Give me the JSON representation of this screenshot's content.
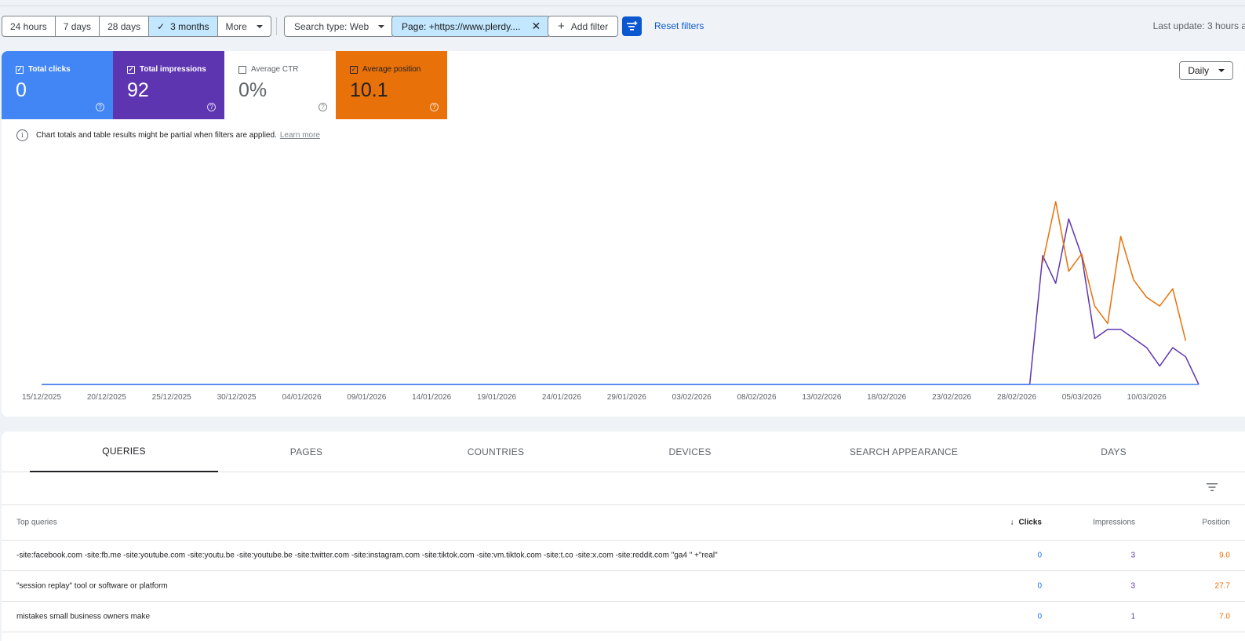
{
  "filters": {
    "ranges": [
      "24 hours",
      "7 days",
      "28 days",
      "3 months",
      "More"
    ],
    "active_range": "3 months",
    "search_type": "Search type: Web",
    "page_filter": "Page: +https://www.plerdy....",
    "add_filter": "Add filter",
    "reset": "Reset filters",
    "last_update": "Last update: 3 hours a"
  },
  "metrics": [
    {
      "label": "Total clicks",
      "value": "0",
      "checked": true,
      "color": "#4285f4"
    },
    {
      "label": "Total impressions",
      "value": "92",
      "checked": true,
      "color": "#5e35b1"
    },
    {
      "label": "Average CTR",
      "value": "0%",
      "checked": false,
      "color": "#ffffff"
    },
    {
      "label": "Average position",
      "value": "10.1",
      "checked": true,
      "color": "#e8710a"
    }
  ],
  "granularity": "Daily",
  "notice": {
    "text": "Chart totals and table results might be partial when filters are applied.",
    "link": "Learn more"
  },
  "chart_data": {
    "type": "line",
    "x": [
      "15/12/2025",
      "16/12/2025",
      "17/12/2025",
      "18/12/2025",
      "19/12/2025",
      "20/12/2025",
      "21/12/2025",
      "22/12/2025",
      "23/12/2025",
      "24/12/2025",
      "25/12/2025",
      "26/12/2025",
      "27/12/2025",
      "28/12/2025",
      "29/12/2025",
      "30/12/2025",
      "31/12/2025",
      "01/01/2026",
      "02/01/2026",
      "03/01/2026",
      "04/01/2026",
      "05/01/2026",
      "06/01/2026",
      "07/01/2026",
      "08/01/2026",
      "09/01/2026",
      "10/01/2026",
      "11/01/2026",
      "12/01/2026",
      "13/01/2026",
      "14/01/2026",
      "15/01/2026",
      "16/01/2026",
      "17/01/2026",
      "18/01/2026",
      "19/01/2026",
      "20/01/2026",
      "21/01/2026",
      "22/01/2026",
      "23/01/2026",
      "24/01/2026",
      "25/01/2026",
      "26/01/2026",
      "27/01/2026",
      "28/01/2026",
      "29/01/2026",
      "30/01/2026",
      "31/01/2026",
      "01/02/2026",
      "02/02/2026",
      "03/02/2026",
      "04/02/2026",
      "05/02/2026",
      "06/02/2026",
      "07/02/2026",
      "08/02/2026",
      "09/02/2026",
      "10/02/2026",
      "11/02/2026",
      "12/02/2026",
      "13/02/2026",
      "14/02/2026",
      "15/02/2026",
      "16/02/2026",
      "17/02/2026",
      "18/02/2026",
      "19/02/2026",
      "20/02/2026",
      "21/02/2026",
      "22/02/2026",
      "23/02/2026",
      "24/02/2026",
      "25/02/2026",
      "26/02/2026",
      "27/02/2026",
      "28/02/2026",
      "01/03/2026",
      "02/03/2026",
      "03/03/2026",
      "04/03/2026",
      "05/03/2026",
      "06/03/2026",
      "07/03/2026",
      "08/03/2026",
      "09/03/2026",
      "10/03/2026",
      "11/03/2026",
      "12/03/2026",
      "13/03/2026",
      "14/03/2026"
    ],
    "tick_labels": [
      "15/12/2025",
      "20/12/2025",
      "25/12/2025",
      "30/12/2025",
      "04/01/2026",
      "09/01/2026",
      "14/01/2026",
      "19/01/2026",
      "24/01/2026",
      "29/01/2026",
      "03/02/2026",
      "08/02/2026",
      "13/02/2026",
      "18/02/2026",
      "23/02/2026",
      "28/02/2026",
      "05/03/2026",
      "10/03/2026"
    ],
    "series": [
      {
        "name": "Total clicks",
        "color": "#4285f4",
        "values": [
          0,
          0,
          0,
          0,
          0,
          0,
          0,
          0,
          0,
          0,
          0,
          0,
          0,
          0,
          0,
          0,
          0,
          0,
          0,
          0,
          0,
          0,
          0,
          0,
          0,
          0,
          0,
          0,
          0,
          0,
          0,
          0,
          0,
          0,
          0,
          0,
          0,
          0,
          0,
          0,
          0,
          0,
          0,
          0,
          0,
          0,
          0,
          0,
          0,
          0,
          0,
          0,
          0,
          0,
          0,
          0,
          0,
          0,
          0,
          0,
          0,
          0,
          0,
          0,
          0,
          0,
          0,
          0,
          0,
          0,
          0,
          0,
          0,
          0,
          0,
          0,
          0,
          0,
          0,
          0,
          0,
          0,
          0,
          0,
          0,
          0,
          0,
          0,
          0,
          0
        ]
      },
      {
        "name": "Total impressions",
        "color": "#5e35b1",
        "values": [
          0,
          0,
          0,
          0,
          0,
          0,
          0,
          0,
          0,
          0,
          0,
          0,
          0,
          0,
          0,
          0,
          0,
          0,
          0,
          0,
          0,
          0,
          0,
          0,
          0,
          0,
          0,
          0,
          0,
          0,
          0,
          0,
          0,
          0,
          0,
          0,
          0,
          0,
          0,
          0,
          0,
          0,
          0,
          0,
          0,
          0,
          0,
          0,
          0,
          0,
          0,
          0,
          0,
          0,
          0,
          0,
          0,
          0,
          0,
          0,
          0,
          0,
          0,
          0,
          0,
          0,
          0,
          0,
          0,
          0,
          0,
          0,
          0,
          0,
          0,
          0,
          0,
          14,
          11,
          18,
          14,
          5,
          6,
          6,
          5,
          4,
          2,
          4,
          3,
          0
        ]
      },
      {
        "name": "Average position",
        "color": "#e8710a",
        "values": [
          null,
          null,
          null,
          null,
          null,
          null,
          null,
          null,
          null,
          null,
          null,
          null,
          null,
          null,
          null,
          null,
          null,
          null,
          null,
          null,
          null,
          null,
          null,
          null,
          null,
          null,
          null,
          null,
          null,
          null,
          null,
          null,
          null,
          null,
          null,
          null,
          null,
          null,
          null,
          null,
          null,
          null,
          null,
          null,
          null,
          null,
          null,
          null,
          null,
          null,
          null,
          null,
          null,
          null,
          null,
          null,
          null,
          null,
          null,
          null,
          null,
          null,
          null,
          null,
          null,
          null,
          null,
          null,
          null,
          null,
          null,
          null,
          null,
          null,
          null,
          null,
          null,
          14,
          21,
          13,
          15,
          9,
          7,
          17,
          12,
          10,
          9,
          11,
          5
        ]
      }
    ]
  },
  "tabs": [
    "QUERIES",
    "PAGES",
    "COUNTRIES",
    "DEVICES",
    "SEARCH APPEARANCE",
    "DAYS"
  ],
  "active_tab": "QUERIES",
  "table": {
    "headers": {
      "query": "Top queries",
      "clicks": "Clicks",
      "impressions": "Impressions",
      "position": "Position"
    },
    "rows": [
      {
        "query": "-site:facebook.com -site:fb.me -site:youtube.com -site:youtu.be -site:youtube.be -site:twitter.com -site:instagram.com -site:tiktok.com -site:vm.tiktok.com -site:t.co -site:x.com -site:reddit.com \"ga4 \" +\"real\"",
        "clicks": "0",
        "impressions": "3",
        "position": "9.0"
      },
      {
        "query": "\"session replay\" tool or software or platform",
        "clicks": "0",
        "impressions": "3",
        "position": "27.7"
      },
      {
        "query": "mistakes small business owners make",
        "clicks": "0",
        "impressions": "1",
        "position": "7.0"
      }
    ]
  }
}
